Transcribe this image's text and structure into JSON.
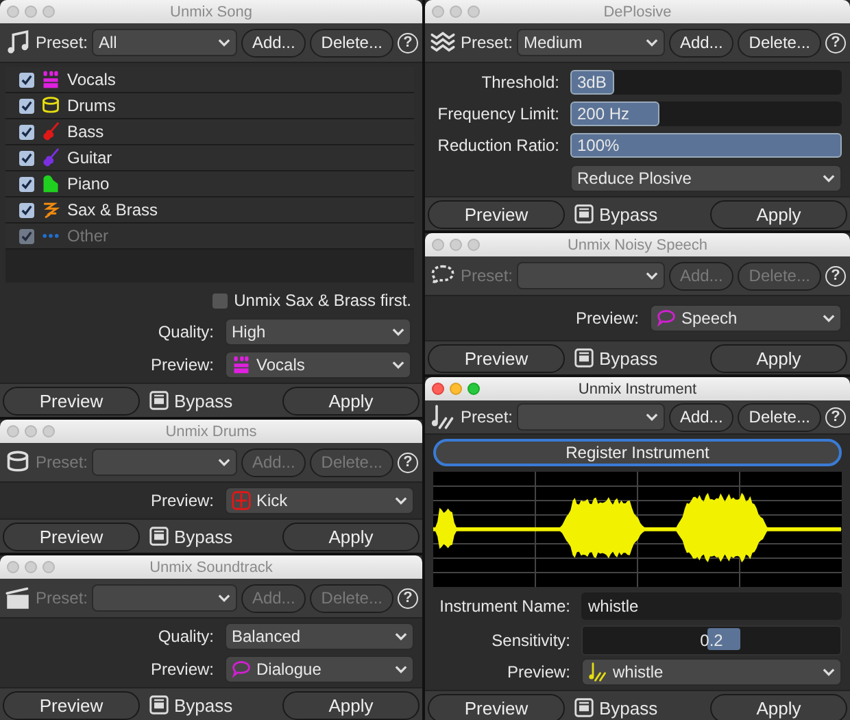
{
  "columns": [
    {
      "windows": [
        {
          "kind": "song",
          "title": "Unmix Song",
          "active": false,
          "toolbar": {
            "label": "Preset:",
            "value": "All",
            "disabled": false,
            "add": "Add...",
            "delete": "Delete...",
            "help": "?"
          },
          "rows": [
            {
              "kind": "stems",
              "items": [
                {
                  "kind": "vocals",
                  "label": "Vocals",
                  "checked": true,
                  "disabled": false,
                  "color": "#e020e0"
                },
                {
                  "kind": "drums",
                  "label": "Drums",
                  "checked": true,
                  "disabled": false,
                  "color": "#e6de10"
                },
                {
                  "kind": "bass",
                  "label": "Bass",
                  "checked": true,
                  "disabled": false,
                  "color": "#e01818"
                },
                {
                  "kind": "guitar",
                  "label": "Guitar",
                  "checked": true,
                  "disabled": false,
                  "color": "#7a30e0"
                },
                {
                  "kind": "piano",
                  "label": "Piano",
                  "checked": true,
                  "disabled": false,
                  "color": "#20d020"
                },
                {
                  "kind": "brass",
                  "label": "Sax & Brass",
                  "checked": true,
                  "disabled": false,
                  "color": "#f08a10"
                },
                {
                  "kind": "other",
                  "label": "Other",
                  "checked": true,
                  "disabled": true,
                  "color": "#2070d0"
                }
              ]
            },
            {
              "kind": "checkbox",
              "label": "Unmix Sax & Brass first.",
              "checked": false
            },
            {
              "kind": "dropdown",
              "label": "Quality:",
              "value": "High"
            },
            {
              "kind": "dropdown",
              "label": "Preview:",
              "option": {
                "kind": "vocals",
                "label": "Vocals"
              }
            }
          ],
          "footer": {
            "preview": "Preview",
            "bypass": "Bypass",
            "apply": "Apply"
          }
        },
        {
          "kind": "drums",
          "title": "Unmix Drums",
          "active": false,
          "toolbar": {
            "label": "Preset:",
            "disabled": true,
            "add": "Add...",
            "delete": "Delete...",
            "help": "?"
          },
          "rows": [
            {
              "kind": "dropdown",
              "label": "Preview:",
              "option": {
                "kind": "kick",
                "label": "Kick"
              }
            }
          ],
          "footer": {
            "preview": "Preview",
            "bypass": "Bypass",
            "apply": "Apply"
          }
        },
        {
          "kind": "soundtrack",
          "title": "Unmix Soundtrack",
          "active": false,
          "toolbar": {
            "label": "Preset:",
            "disabled": true,
            "add": "Add...",
            "delete": "Delete...",
            "help": "?"
          },
          "rows": [
            {
              "kind": "dropdown",
              "label": "Quality:",
              "value": "Balanced"
            },
            {
              "kind": "dropdown",
              "label": "Preview:",
              "option": {
                "kind": "speech",
                "label": "Dialogue"
              }
            }
          ],
          "footer": {
            "preview": "Preview",
            "bypass": "Bypass",
            "apply": "Apply"
          }
        }
      ]
    },
    {
      "windows": [
        {
          "kind": "deplosive",
          "title": "DePlosive",
          "active": false,
          "toolbar": {
            "label": "Preset:",
            "value": "Medium",
            "disabled": false,
            "add": "Add...",
            "delete": "Delete...",
            "help": "?"
          },
          "rows": [
            {
              "kind": "bar",
              "label": "Threshold:",
              "reading": "3dB",
              "level": 0.16
            },
            {
              "kind": "bar",
              "label": "Frequency Limit:",
              "reading": "200 Hz",
              "level": 0.33
            },
            {
              "kind": "bar",
              "label": "Reduction Ratio:",
              "reading": "100%",
              "level": 1
            },
            {
              "kind": "dropdown",
              "value": "Reduce Plosive"
            }
          ],
          "footer": {
            "preview": "Preview",
            "bypass": "Bypass",
            "apply": "Apply"
          }
        },
        {
          "kind": "speech",
          "title": "Unmix Noisy Speech",
          "active": false,
          "toolbar": {
            "label": "Preset:",
            "disabled": true,
            "add": "Add...",
            "delete": "Delete...",
            "help": "?"
          },
          "rows": [
            {
              "kind": "dropdown",
              "label": "Preview:",
              "option": {
                "kind": "speech",
                "label": "Speech"
              }
            }
          ],
          "footer": {
            "preview": "Preview",
            "bypass": "Bypass",
            "apply": "Apply"
          }
        },
        {
          "kind": "instrument",
          "title": "Unmix Instrument",
          "active": true,
          "toolbar": {
            "label": "Preset:",
            "disabled": false,
            "add": "Add...",
            "delete": "Delete...",
            "help": "?"
          },
          "rows": [
            {
              "kind": "button",
              "label": "Register Instrument",
              "focused": true
            },
            {
              "kind": "waveform"
            },
            {
              "kind": "field",
              "label": "Instrument Name:",
              "value": "whistle"
            },
            {
              "kind": "slider",
              "label": "Sensitivity:",
              "reading": "0.2",
              "level": 0.55
            },
            {
              "kind": "dropdown",
              "label": "Preview:",
              "option": {
                "kind": "instrument",
                "label": "whistle"
              }
            }
          ],
          "footer": {
            "preview": "Preview",
            "bypass": "Bypass",
            "apply": "Apply"
          }
        }
      ]
    }
  ]
}
